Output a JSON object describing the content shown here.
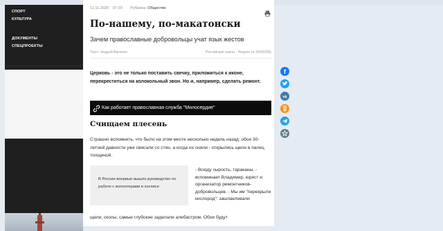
{
  "colors": {
    "background": "#e4ebf2",
    "sidebar": "#1f1f1f",
    "relbox": "#0b0b0b",
    "facebook": "#1877f2",
    "twitter": "#1da1f2",
    "vk": "#4a76a8",
    "ok": "#f7931e",
    "telegram": "#2aa3df",
    "bookmark": "#607d8b"
  },
  "sidebar": {
    "items": [
      "СПОРТ",
      "КУЛЬТУРА",
      "ДОКУМЕНТЫ",
      "СПЕЦПРОЕКТЫ"
    ]
  },
  "article": {
    "date": "11.11.2020",
    "time": "07:29",
    "rubric_label": "Рубрика:",
    "rubric": "Общество",
    "title": "По-нашему, по-макатонски",
    "subtitle": "Зачем православные добровольцы учат язык жестов",
    "author": "Текст: Андрей Васянин",
    "source": "Российская газета - Неделя № 254(8308)",
    "lead": "Церковь - это не только поставить свечку, приложиться к иконе, перекреститься на колокольный звон. Но и, например, сделать ремонт.",
    "related_link": "Как работает православная служба \"Милосердие\"",
    "heading": "Счищаем плесень",
    "para1": "Страшно вспомнить, что было на этом месте несколько недель назад: обои 30-летней давности уже свисали со стен, а когда их сняли - открылись щели в палец толщиной.",
    "quote": "В России впервые вышло руководство по работе с волонтерами в хосписе",
    "para2": "- Всюду сырость, тараканы, - вспоминает Владимир, юрист и организатор ремонтников-добровольцев. - Мы им \"перекрыли кислород\": зашпаклевали",
    "para3": "щели, сколы, самые глубокие заделали алебастром. Обои будут"
  },
  "icons": {
    "print": "print-icon",
    "related": "link-icon",
    "social": [
      "facebook-icon",
      "twitter-icon",
      "vk-icon",
      "ok-icon",
      "telegram-icon",
      "bookmark-icon"
    ]
  }
}
